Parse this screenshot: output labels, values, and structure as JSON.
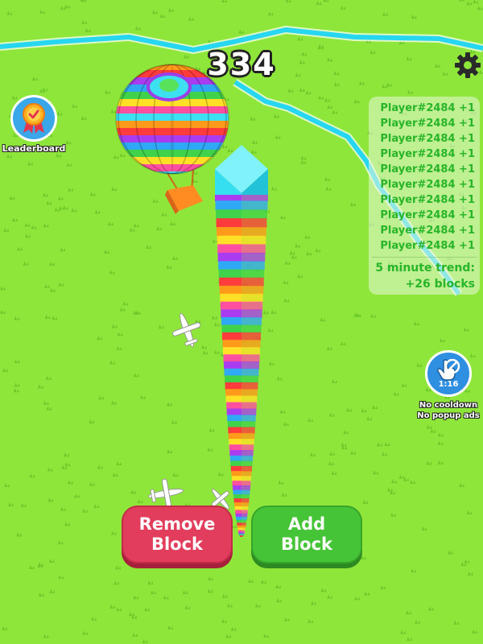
{
  "hud": {
    "score": "334",
    "settings_icon": "gear-icon"
  },
  "leaderboard": {
    "label": "Leaderboard",
    "icon": "ribbon-medal-icon"
  },
  "activity_feed": {
    "entries": [
      "Player#2484 +1",
      "Player#2484 +1",
      "Player#2484 +1",
      "Player#2484 +1",
      "Player#2484 +1",
      "Player#2484 +1",
      "Player#2484 +1",
      "Player#2484 +1",
      "Player#2484 +1",
      "Player#2484 +1"
    ],
    "trend_line1": "5 minute trend:",
    "trend_line2": "+26 blocks"
  },
  "no_cooldown": {
    "timer": "1:16",
    "line1": "No cooldown",
    "line2": "No popup ads",
    "icon": "no-tap-hand-icon"
  },
  "controls": {
    "remove_line1": "Remove",
    "remove_line2": "Block",
    "add_line1": "Add",
    "add_line2": "Block"
  },
  "colors": {
    "grass": "#8fe63a",
    "river": "#27d6f0",
    "remove_button": "#e23d5c",
    "add_button": "#46c437",
    "feed_text": "#28b528",
    "tower_cap": "#36dff0",
    "tower_stripes": [
      "#a93cf0",
      "#2fa8f5",
      "#40d24a",
      "#ff3b3b",
      "#ff9a1a",
      "#ffe027",
      "#ff4fa0"
    ]
  }
}
